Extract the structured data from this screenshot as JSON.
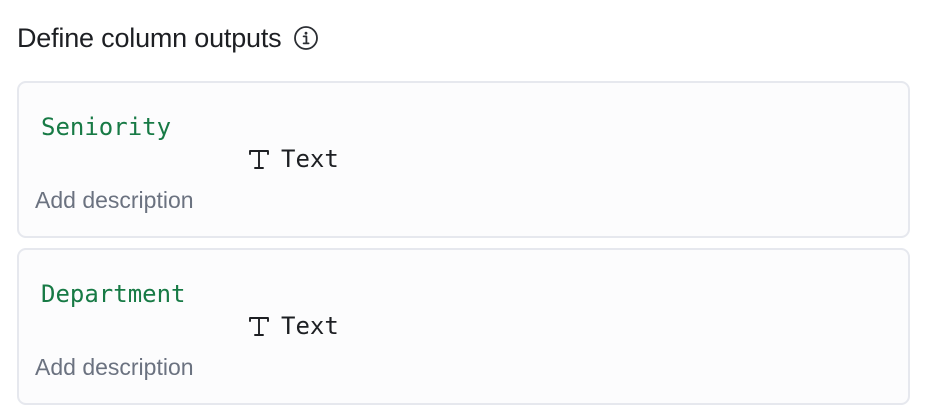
{
  "header": {
    "title": "Define column outputs",
    "info_icon": "info-circle-icon"
  },
  "columns": [
    {
      "name": "Seniority",
      "type_icon": "text-type-icon",
      "type_label": "Text",
      "description_placeholder": "Add description"
    },
    {
      "name": "Department",
      "type_icon": "text-type-icon",
      "type_label": "Text",
      "description_placeholder": "Add description"
    }
  ],
  "colors": {
    "column_name": "#177a45",
    "placeholder": "#6b7280",
    "card_border": "#e6e8ee",
    "card_background": "#fcfcfd"
  }
}
